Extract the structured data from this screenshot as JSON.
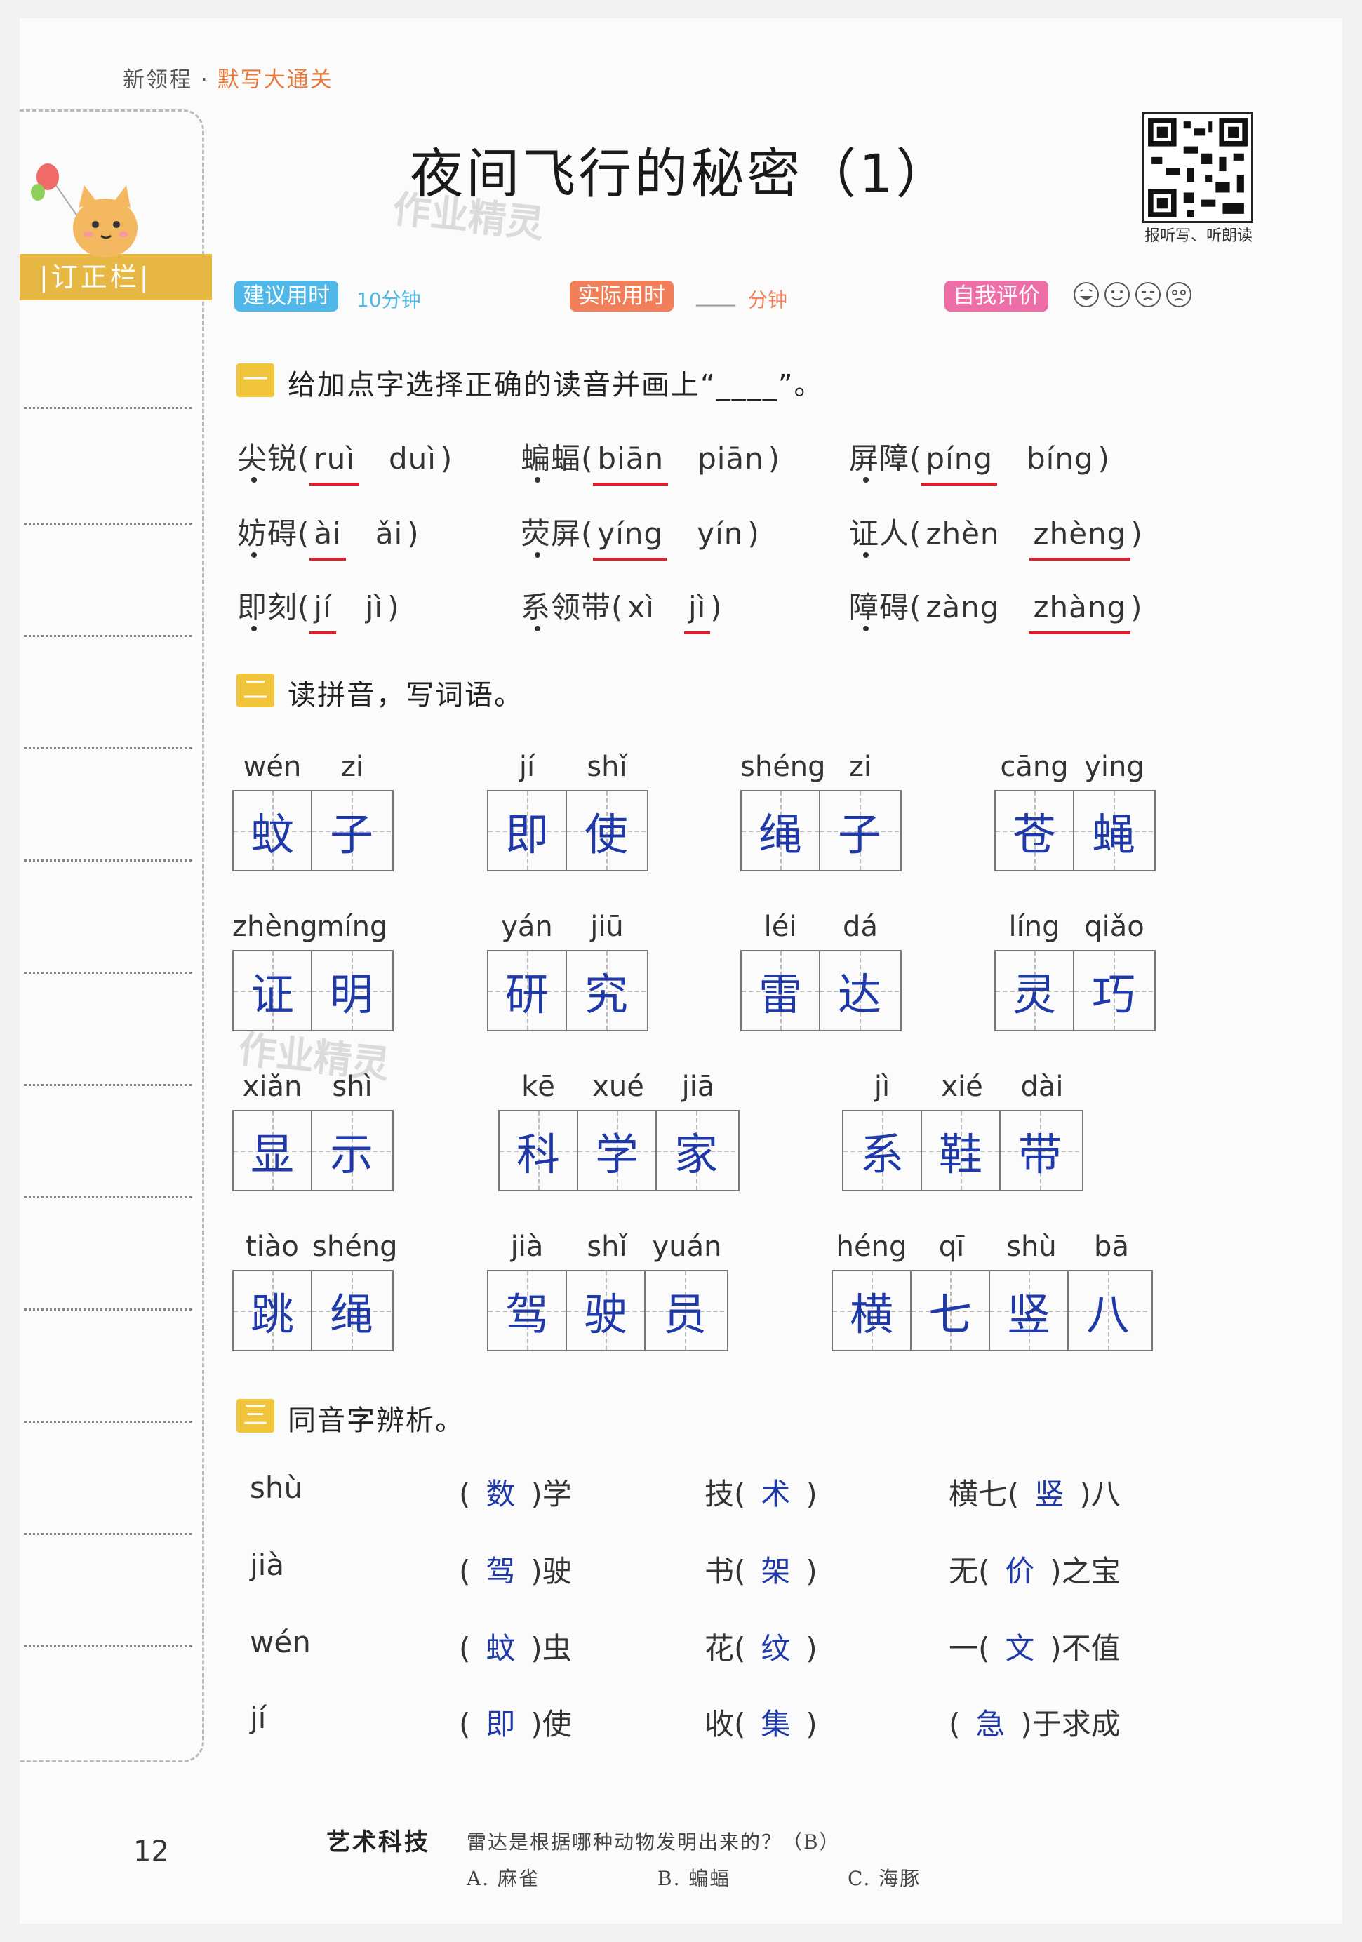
{
  "header": {
    "series": "新领程",
    "series_sep": "·",
    "subtitle": "默写大通关",
    "title": "夜间飞行的秘密（1）",
    "qr_caption": "报听写、听朗读",
    "watermark": "作业精灵"
  },
  "sidebar": {
    "label": "|订正栏|"
  },
  "meta": {
    "suggested_label": "建议用时",
    "suggested_value": "10分钟",
    "actual_label": "实际用时",
    "actual_blank": "____",
    "actual_unit": "分钟",
    "self_eval_label": "自我评价",
    "faces": [
      "😄",
      "🙂",
      "😔",
      "😣"
    ],
    "colors": {
      "suggested": "#4fb8e8",
      "actual": "#f07f5a",
      "self_eval": "#ee6fa8",
      "section": "#f0c53b",
      "answer": "#1f3aa8",
      "underline": "#d8232a"
    }
  },
  "section1": {
    "num": "一",
    "title": "给加点字选择正确的读音并画上“____”。",
    "items": [
      {
        "word": "尖锐",
        "open": "(",
        "a": "ruì",
        "b": "duì",
        "close": ")",
        "answer": "a"
      },
      {
        "word": "蝙蝠",
        "open": "(",
        "a": "biān",
        "b": "piān",
        "close": ")",
        "answer": "a"
      },
      {
        "word": "屏障",
        "open": "(",
        "a": "píng",
        "b": "bíng",
        "close": ")",
        "answer": "a"
      },
      {
        "word": "妨碍",
        "open": "(",
        "a": "ài",
        "b": "ǎi",
        "close": ")",
        "answer": "a"
      },
      {
        "word": "荧屏",
        "open": "(",
        "a": "yíng",
        "b": "yín",
        "close": ")",
        "answer": "a"
      },
      {
        "word": "证人",
        "open": "(",
        "a": "zhèn",
        "b": "zhèng",
        "close": ")",
        "answer": "b"
      },
      {
        "word": "即刻",
        "open": "(",
        "a": "jí",
        "b": "jì",
        "close": ")",
        "answer": "a"
      },
      {
        "word": "系领带",
        "open": "(",
        "a": "xì",
        "b": "jì",
        "close": ")",
        "answer": "b"
      },
      {
        "word": "障碍",
        "open": "(",
        "a": "zàng",
        "b": "zhàng",
        "close": ")",
        "answer": "b"
      }
    ]
  },
  "section2": {
    "num": "二",
    "title": "读拼音，写词语。",
    "words": [
      {
        "pinyin": [
          "wén",
          "zi"
        ],
        "chars": [
          "蚊",
          "子"
        ]
      },
      {
        "pinyin": [
          "jí",
          "shǐ"
        ],
        "chars": [
          "即",
          "使"
        ]
      },
      {
        "pinyin": [
          "shéng",
          "zi"
        ],
        "chars": [
          "绳",
          "子"
        ]
      },
      {
        "pinyin": [
          "cāng",
          "ying"
        ],
        "chars": [
          "苍",
          "蝇"
        ]
      },
      {
        "pinyin": [
          "zhèng",
          "míng"
        ],
        "chars": [
          "证",
          "明"
        ]
      },
      {
        "pinyin": [
          "yán",
          "jiū"
        ],
        "chars": [
          "研",
          "究"
        ]
      },
      {
        "pinyin": [
          "léi",
          "dá"
        ],
        "chars": [
          "雷",
          "达"
        ]
      },
      {
        "pinyin": [
          "líng",
          "qiǎo"
        ],
        "chars": [
          "灵",
          "巧"
        ]
      },
      {
        "pinyin": [
          "xiǎn",
          "shì"
        ],
        "chars": [
          "显",
          "示"
        ]
      },
      {
        "pinyin": [
          "kē",
          "xué",
          "jiā"
        ],
        "chars": [
          "科",
          "学",
          "家"
        ]
      },
      {
        "pinyin": [
          "jì",
          "xié",
          "dài"
        ],
        "chars": [
          "系",
          "鞋",
          "带"
        ]
      },
      {
        "pinyin": [
          "tiào",
          "shéng"
        ],
        "chars": [
          "跳",
          "绳"
        ]
      },
      {
        "pinyin": [
          "jià",
          "shǐ",
          "yuán"
        ],
        "chars": [
          "驾",
          "驶",
          "员"
        ]
      },
      {
        "pinyin": [
          "héng",
          "qī",
          "shù",
          "bā"
        ],
        "chars": [
          "横",
          "七",
          "竖",
          "八"
        ]
      }
    ]
  },
  "section3": {
    "num": "三",
    "title": "同音字辨析。",
    "rows": [
      {
        "py": "shù",
        "c1": {
          "pre": "(",
          "ans": "数",
          "post": ")学"
        },
        "c2": {
          "pre": "技(",
          "ans": "术",
          "post": ")"
        },
        "c3": {
          "pre": "横七(",
          "ans": "竖",
          "post": ")八"
        }
      },
      {
        "py": "jià",
        "c1": {
          "pre": "(",
          "ans": "驾",
          "post": ")驶"
        },
        "c2": {
          "pre": "书(",
          "ans": "架",
          "post": ")"
        },
        "c3": {
          "pre": "无(",
          "ans": "价",
          "post": ")之宝"
        }
      },
      {
        "py": "wén",
        "c1": {
          "pre": "(",
          "ans": "蚊",
          "post": ")虫"
        },
        "c2": {
          "pre": "花(",
          "ans": "纹",
          "post": ")"
        },
        "c3": {
          "pre": "一(",
          "ans": "文",
          "post": ")不值"
        }
      },
      {
        "py": "jí",
        "c1": {
          "pre": "(",
          "ans": "即",
          "post": ")使"
        },
        "c2": {
          "pre": "收(",
          "ans": "集",
          "post": ")"
        },
        "c3": {
          "pre": "(",
          "ans": "急",
          "post": ")于求成"
        }
      }
    ]
  },
  "footer": {
    "page_number": "12",
    "label": "艺术科技",
    "question": "雷达是根据哪种动物发明出来的？（B）",
    "options": [
      "A. 麻雀",
      "B. 蝙蝠",
      "C. 海豚"
    ]
  }
}
